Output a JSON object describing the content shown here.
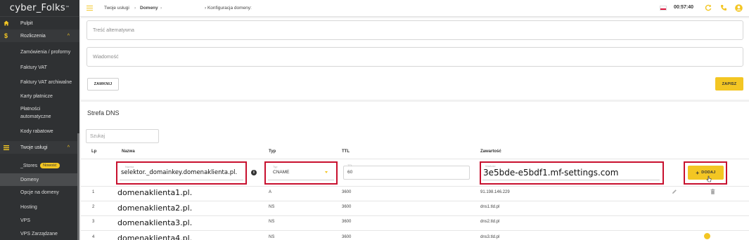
{
  "sidebar": {
    "logo": "cyber_Folks",
    "logo_tm": "™",
    "items": [
      {
        "label": "Pulpit",
        "icon": "home-icon"
      },
      {
        "label": "Rozliczenia",
        "icon": "dollar-icon"
      },
      {
        "label": "Zamówienia / proformy"
      },
      {
        "label": "Faktury VAT"
      },
      {
        "label": "Faktury VAT archiwalne"
      },
      {
        "label": "Karty płatnicze"
      },
      {
        "label": "Płatności"
      },
      {
        "label": "automatyczne"
      },
      {
        "label": "Kody rabatowe"
      },
      {
        "label": "Twoje usługi",
        "icon": "list-icon"
      },
      {
        "label": "_Stores"
      },
      {
        "label": "Domeny"
      },
      {
        "label": "Opcje na domeny"
      },
      {
        "label": "Hosting"
      },
      {
        "label": "VPS"
      },
      {
        "label": "VPS Zarządzane"
      }
    ],
    "new_badge": "Nowość",
    "accent": "#f3c623",
    "background": "#2f3133"
  },
  "topbar": {
    "breadcrumb": [
      "Twoje usługi",
      "Domeny"
    ],
    "breadcrumb_sep": "›",
    "subpage": "› Konfiguracja domeny:",
    "time": "00:57:40",
    "icons": [
      "menu-icon",
      "flag-icon",
      "refresh-icon",
      "phone-icon",
      "user-icon"
    ]
  },
  "form": {
    "alt_text_placeholder": "Treść alternatywna",
    "message_placeholder": "Wiadomość",
    "close_label": "ZAMKNIJ",
    "save_label": "ZAPISZ"
  },
  "dns": {
    "title": "Strefa DNS",
    "search_placeholder": "Szukaj",
    "columns": [
      "Lp",
      "Nazwa",
      "Typ",
      "TTL",
      "Zawartość"
    ],
    "new_record": {
      "name_label": "Nazwa",
      "name_value": "selektor._domainkey.domenaklienta.pl.",
      "type_label": "Typ",
      "type_value": "CNAME",
      "ttl_label": "TTL",
      "ttl_value": "60",
      "content_label": "Wartość",
      "content_value": "3e5bde-e5bdf1.mf-settings.com",
      "add_label": "DODAJ",
      "add_plus": "+"
    },
    "rows": [
      {
        "lp": "1",
        "name": "domenaklienta1.pl.",
        "type": "A",
        "ttl": "3600",
        "content": "91.198.146.229"
      },
      {
        "lp": "2",
        "name": "domenaklienta2.pl.",
        "type": "NS",
        "ttl": "3600",
        "content": "dns1.tld.pl"
      },
      {
        "lp": "3",
        "name": "domenaklienta3.pl.",
        "type": "NS",
        "ttl": "3600",
        "content": "dns2.tld.pl"
      },
      {
        "lp": "4",
        "name": "domenaklienta4.pl.",
        "type": "NS",
        "ttl": "3600",
        "content": "dns3.tld.pl"
      }
    ],
    "highlight_color": "#c8102e"
  }
}
